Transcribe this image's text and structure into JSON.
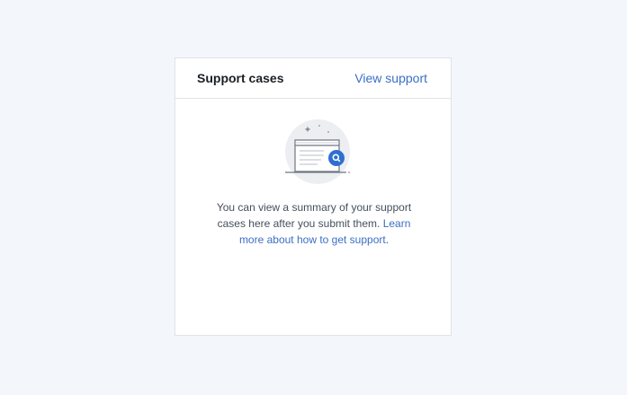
{
  "card": {
    "title": "Support cases",
    "header_link": "View support",
    "empty_state": {
      "illustration_icon": "browser-window-search-icon",
      "message_text": "You can view a summary of your support cases here after you submit them.",
      "link_text": "Learn more about how to get support",
      "message_end": "."
    }
  },
  "colors": {
    "page_background": "#f3f6fa",
    "card_background": "#ffffff",
    "link": "#3b6fc4",
    "badge": "#2f6fd1"
  }
}
